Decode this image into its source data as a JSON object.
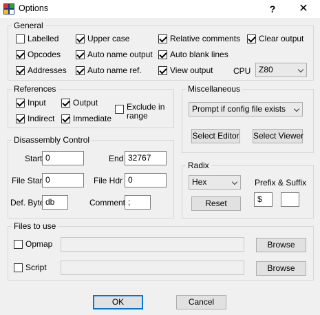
{
  "window": {
    "title": "Options",
    "help": "?",
    "close": "✕"
  },
  "general": {
    "title": "General",
    "labelled": "Labelled",
    "opcodes": "Opcodes",
    "addresses": "Addresses",
    "upper_case": "Upper case",
    "auto_name_output": "Auto name output",
    "auto_name_ref": "Auto name ref.",
    "relative_comments": "Relative comments",
    "auto_blank_lines": "Auto blank lines",
    "view_output": "View output",
    "clear_output": "Clear output",
    "cpu_label": "CPU",
    "cpu_value": "Z80"
  },
  "references": {
    "title": "References",
    "input": "Input",
    "output": "Output",
    "indirect": "Indirect",
    "immediate": "Immediate",
    "exclude_in_range": "Exclude in range"
  },
  "misc": {
    "title": "Miscellaneous",
    "config_option": "Prompt if config file exists",
    "select_editor": "Select Editor",
    "select_viewer": "Select Viewer"
  },
  "disassembly": {
    "title": "Disassembly Control",
    "start_label": "Start",
    "start_value": "0",
    "end_label": "End",
    "end_value": "32767",
    "file_start_label": "File Start",
    "file_start_value": "0",
    "file_hdr_label": "File Hdr",
    "file_hdr_value": "0",
    "def_byte_label": "Def. Byte",
    "def_byte_value": "db",
    "comment_label": "Comment",
    "comment_value": ";"
  },
  "radix": {
    "title": "Radix",
    "value": "Hex",
    "reset": "Reset",
    "prefix_suffix_label": "Prefix & Suffix",
    "prefix_value": "$",
    "suffix_value": ""
  },
  "files": {
    "title": "Files to use",
    "opmap": "Opmap",
    "script": "Script",
    "browse": "Browse"
  },
  "footer": {
    "ok": "OK",
    "cancel": "Cancel"
  }
}
